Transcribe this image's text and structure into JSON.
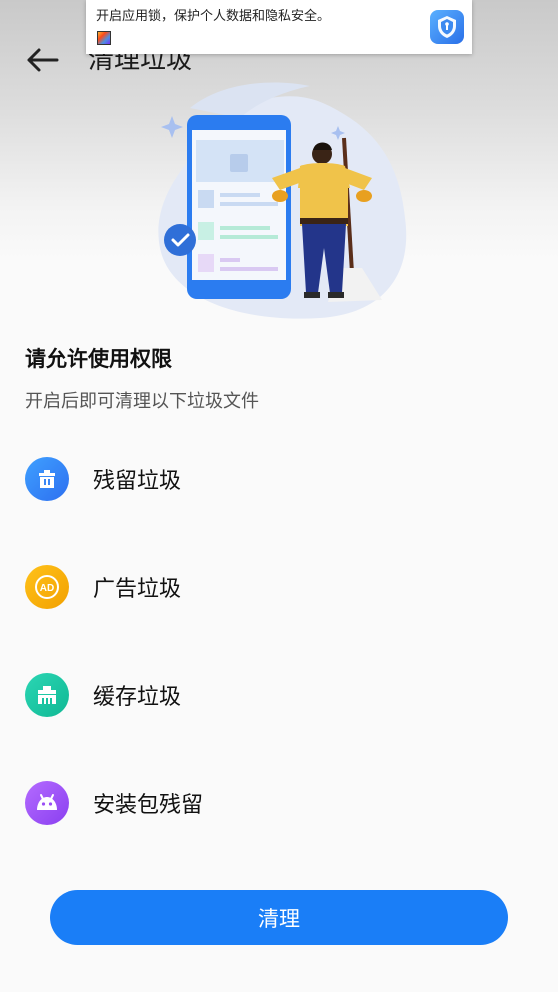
{
  "header": {
    "title": "清理垃圾"
  },
  "toast": {
    "text": "开启应用锁，保护个人数据和隐私安全。"
  },
  "permission": {
    "title": "请允许使用权限",
    "subtitle": "开启后即可清理以下垃圾文件"
  },
  "items": [
    {
      "label": "残留垃圾",
      "icon": "trash-icon",
      "color": "#2f7ff5"
    },
    {
      "label": "广告垃圾",
      "icon": "ad-icon",
      "color": "#f7a800"
    },
    {
      "label": "缓存垃圾",
      "icon": "cache-icon",
      "color": "#12c0a0"
    },
    {
      "label": "安装包残留",
      "icon": "android-icon",
      "color": "#9b4ff5"
    }
  ],
  "actions": {
    "clean_label": "清理"
  },
  "colors": {
    "accent": "#1a7ef7"
  }
}
